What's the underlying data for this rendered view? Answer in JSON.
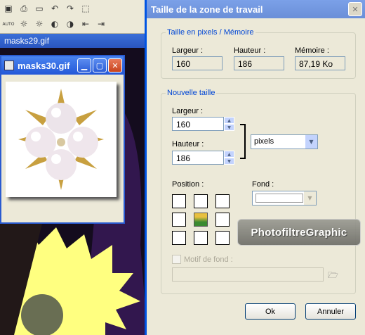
{
  "background_app": {
    "toolbar_icons": [
      "paint-bucket-icon",
      "printer-icon",
      "eraser-icon",
      "undo-icon",
      "redo-icon",
      "selection-icon",
      "brightness-icon",
      "brightness-plus-icon",
      "contrast-minus-icon",
      "contrast-plus-icon",
      "align-left-icon",
      "align-right-icon"
    ],
    "auto_label": "AUTO",
    "behind_window_title": "masks29.gif",
    "image_window_title": "masks30.gif"
  },
  "dialog": {
    "title": "Taille de la zone de travail",
    "pixel_section": {
      "legend": "Taille en pixels / Mémoire",
      "width_label": "Largeur :",
      "width_value": "160",
      "height_label": "Hauteur :",
      "height_value": "186",
      "memory_label": "Mémoire :",
      "memory_value": "87,19 Ko"
    },
    "new_size_section": {
      "legend": "Nouvelle taille",
      "width_label": "Largeur :",
      "width_value": "160",
      "height_label": "Hauteur :",
      "height_value": "186",
      "unit_selected": "pixels",
      "position_label": "Position :",
      "position_selected": "center",
      "background_label": "Fond :",
      "background_color": "#ffffff",
      "pattern_label": "Motif de fond :",
      "pattern_path": ""
    },
    "ok_label": "Ok",
    "cancel_label": "Annuler"
  },
  "watermark_text": "PhotofiltreGraphic"
}
